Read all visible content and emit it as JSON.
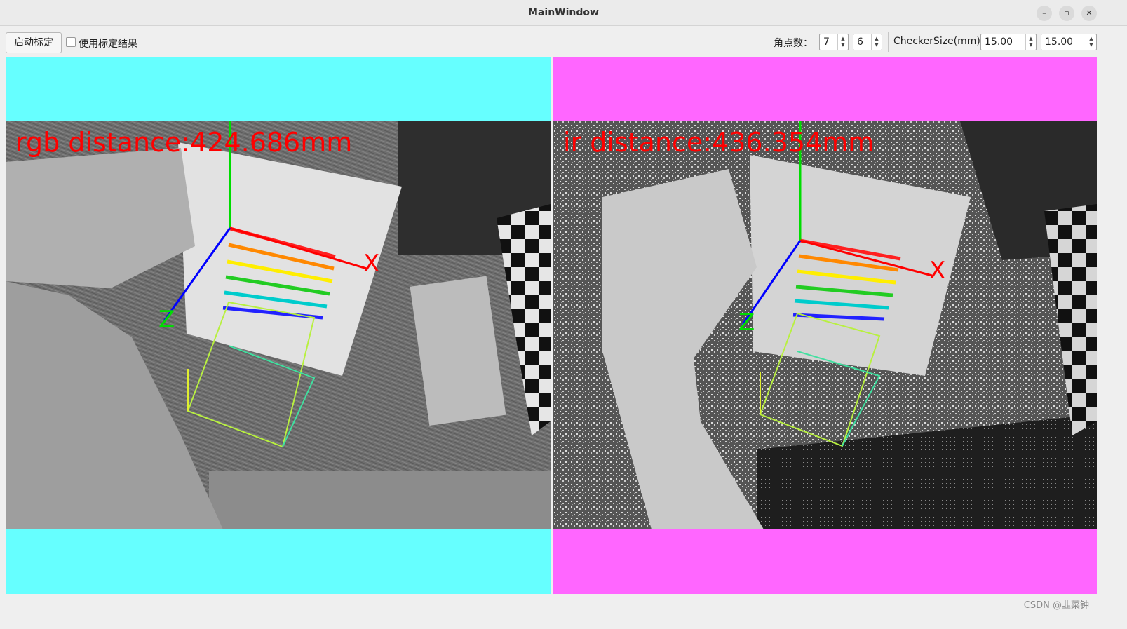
{
  "window": {
    "title": "MainWindow",
    "controls": {
      "minimize": "–",
      "maximize": "▫",
      "close": "✕"
    }
  },
  "toolbar": {
    "start_button": "启动标定",
    "use_result_checkbox": {
      "label": "使用标定结果",
      "checked": false
    },
    "corner_label": "角点数：",
    "corner_cols": "7",
    "corner_rows": "6",
    "checker_label": "CheckerSize(mm):",
    "checker_w": "15.00",
    "checker_h": "15.00"
  },
  "views": {
    "rgb": {
      "overlay": "rgb distance:424.686mm",
      "background": "#66ffff",
      "axis_x": "X",
      "axis_z": "Z"
    },
    "ir": {
      "overlay": "ir distance:436.354mm",
      "background": "#ff66ff",
      "axis_x": "X",
      "axis_z": "Z"
    }
  },
  "watermark": "CSDN @韭菜钟",
  "icons": {
    "spin_up": "▲",
    "spin_down": "▼"
  }
}
